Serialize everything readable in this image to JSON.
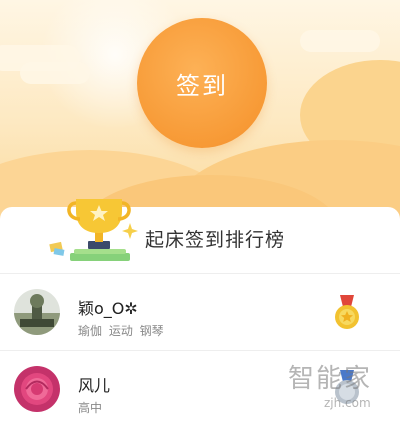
{
  "signin": {
    "label": "签到"
  },
  "leaderboard": {
    "title": "起床签到排行榜"
  },
  "users": [
    {
      "name": "颖o_O✲",
      "tags": "瑜伽 运动 钢琴",
      "medal": "gold-medal-icon"
    },
    {
      "name": "风儿",
      "tags": "高中",
      "medal": "silver-medal-icon"
    }
  ],
  "watermark": {
    "text": "智能家",
    "url": "zjh.com"
  },
  "colors": {
    "sun": "#f79a36",
    "sky": "#fde9c2",
    "gold": "#f2c230",
    "ribbon": "#e0463a",
    "text": "#333333",
    "subtext": "#888888"
  }
}
